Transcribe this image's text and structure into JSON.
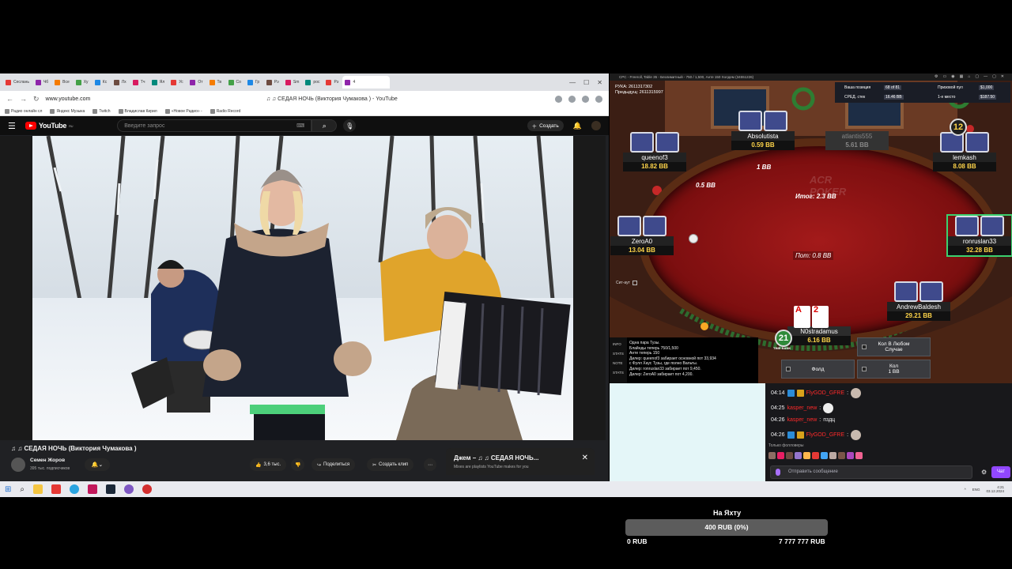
{
  "colors": {
    "youtube_red": "#ff0000",
    "felt": "#8a1414",
    "stack_gold": "#ffd54a",
    "active_seat": "#3bd16f",
    "twitch_purple": "#9147ff",
    "alias_red": "#ff2a2a"
  },
  "browser": {
    "tabs": [
      "Сеслань",
      "Чб",
      "Все",
      "Ху",
      "Кс",
      "Лх",
      "Тч",
      "Ял",
      "Ус",
      "От",
      "Тв",
      "Со",
      "Гр",
      "Рэ",
      "Sm",
      "рос",
      "Рэ",
      "4"
    ],
    "url": "www.youtube.com",
    "page_title": "♫ ♫ СЕДАЯ НОЧЬ (Виктория Чумакова ) - YouTube",
    "bookmarks": [
      "Радио онлайн сл",
      "Яндекс Музыка",
      "Twitch",
      "Владислав Кирил",
      "«Новое Радио» -",
      "Radio Record"
    ]
  },
  "youtube": {
    "logo": "YouTube",
    "logo_region": "RU",
    "search_placeholder": "Введите запрос",
    "create_label": "Создать",
    "video_title": "♫ ♫ СЕДАЯ НОЧЬ (Виктория Чумакова )",
    "channel_name": "Семен Жоров",
    "channel_subs": "395 тыс. подписчиков",
    "likes": "3,6 тыс.",
    "share_label": "Поделиться",
    "clip_label": "Создать клип",
    "mix_title": "Джем – ♫ ♫ СЕДАЯ НОЧЬ...",
    "mix_sub": "Mixes are playlists YouTube makes for you"
  },
  "poker": {
    "window_title": "CPC - Freeroll, Table 35 - Безлимитный - 750 / 1,500, Анте 150 Холдем (34551226)",
    "hand_line1": "РУКА: 2611317302",
    "hand_line2": "Предыдущ: 2611315997",
    "stats": {
      "position_label": "Ваша позиция",
      "position_value": "68 of 81",
      "prize_label": "Призовой пул",
      "prize_value": "$1,000",
      "avg_label": "СРЕД. стек",
      "avg_value": "16.46 BB",
      "first_label": "1-е место",
      "first_value": "$187.50"
    },
    "seats": [
      {
        "name": "queenof3",
        "stack": "18.82 BB"
      },
      {
        "name": "Absolutista",
        "stack": "0.59 BB"
      },
      {
        "name": "atlantis555",
        "stack": "5.61 BB"
      },
      {
        "name": "lemkash",
        "stack": "8.08 BB"
      },
      {
        "name": "ZeroA0",
        "stack": "13.04 BB"
      },
      {
        "name": "ronruslan33",
        "stack": "32.28 BB"
      },
      {
        "name": "AndrewBaldesh",
        "stack": "29.21 BB"
      },
      {
        "name": "N0stradamus",
        "stack": "6.16 BB"
      }
    ],
    "bet_sb": "0.5 BB",
    "bet_bb": "1 BB",
    "total": "Итог: 2.3 BB",
    "pot": "Пот: 0.8 BB",
    "logo_top": "ACR",
    "logo_bottom": "POKER",
    "time_bank_top": "12",
    "time_bank_hero": "21",
    "time_bank_label": "TIME BANK",
    "hero_cards": [
      "A",
      "2"
    ],
    "sitout_label": "Сит-аут",
    "log_tabs": [
      "INFO",
      "STATS",
      "NOTE",
      "STATS"
    ],
    "log_lines": [
      "Одна пара Тузы.",
      "Блайнды теперь 750/1,500",
      "Анте теперь 150",
      "Дилер: queenof3 забирает основной пот 33,934",
      "с Фулл Хаус Тузы, где полно Вальты.",
      "Дилер: ronruslan33 забирает пот 9,450.",
      "Дилер: ZeroA0 забирает пот 4,200."
    ],
    "actions": {
      "call_any": "Кол В Любом Случае",
      "fold": "Фолд",
      "call": "Кол",
      "call_amount": "1 BB"
    }
  },
  "chat": {
    "messages": [
      {
        "time": "04:14",
        "user": "FlyGOD_GFRE"
      },
      {
        "time": "04:25",
        "user": "kasper_new"
      },
      {
        "time": "04:26",
        "user": "kasper_new",
        "text": "пздц"
      },
      {
        "time": "04:26",
        "user": "FlyGOD_GFRE"
      }
    ],
    "followers_label": "Только фолловеры",
    "input_placeholder": "Отправить сообщение",
    "send_label": "Чат"
  },
  "taskbar": {
    "lang": "ENG",
    "time": "4:21",
    "date": "03.12.2024"
  },
  "goal": {
    "title": "На Яхту",
    "progress_text": "400 RUB (0%)",
    "progress_fraction": 0,
    "min": "0 RUB",
    "max": "7 777 777 RUB"
  }
}
